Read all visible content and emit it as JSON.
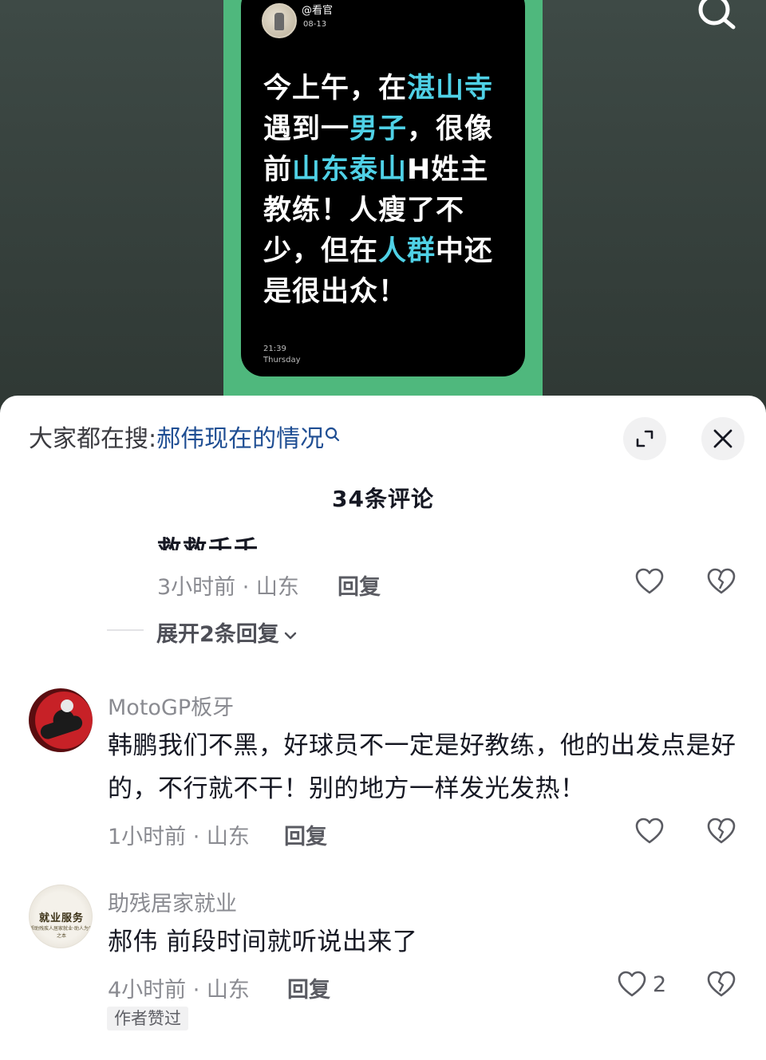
{
  "post": {
    "username": "@看官",
    "date": "08-13",
    "text_segments": [
      {
        "text": "今上午，在",
        "hl": false
      },
      {
        "text": "湛山寺",
        "hl": true
      },
      {
        "text": "遇到一",
        "hl": false
      },
      {
        "text": "男子",
        "hl": true
      },
      {
        "text": "，很像前",
        "hl": false
      },
      {
        "text": "山东泰山",
        "hl": true
      },
      {
        "text": "H姓主教练！人瘦了不少，但在",
        "hl": false
      },
      {
        "text": "人群",
        "hl": true
      },
      {
        "text": "中还是很出众！",
        "hl": false
      }
    ],
    "time": "21:39",
    "weekday": "Thursday",
    "highlight_color": "#4fd1e6",
    "frame_color": "#4fb87d"
  },
  "search_bar": {
    "prefix": "大家都在搜:",
    "query": "郝伟现在的情况",
    "icon": "search-icon"
  },
  "panel": {
    "count_title": "34条评论",
    "expand_icon": "expand-icon",
    "close_icon": "close-icon"
  },
  "comments": [
    {
      "partial_text": "救救千千",
      "time_location": "3小时前 · 山东",
      "reply_label": "回复",
      "expand_replies_label": "展开2条回复",
      "like_icon": "heart-icon",
      "dislike_icon": "broken-heart-icon"
    },
    {
      "username": "MotoGP板牙",
      "text": "韩鹏我们不黑，好球员不一定是好教练，他的出发点是好的，不行就不干！别的地方一样发光发热！",
      "time_location": "1小时前 · 山东",
      "reply_label": "回复",
      "like_icon": "heart-icon",
      "dislike_icon": "broken-heart-icon"
    },
    {
      "username": "助残居家就业",
      "avatar_text": "就业服务",
      "avatar_subtext": "帮助残疾人居家就业·助人为乐之本",
      "text": "郝伟 前段时间就听说出来了",
      "time_location": "4小时前 · 山东",
      "reply_label": "回复",
      "like_count": "2",
      "author_tag": "作者赞过",
      "like_icon": "heart-icon",
      "dislike_icon": "broken-heart-icon"
    }
  ]
}
